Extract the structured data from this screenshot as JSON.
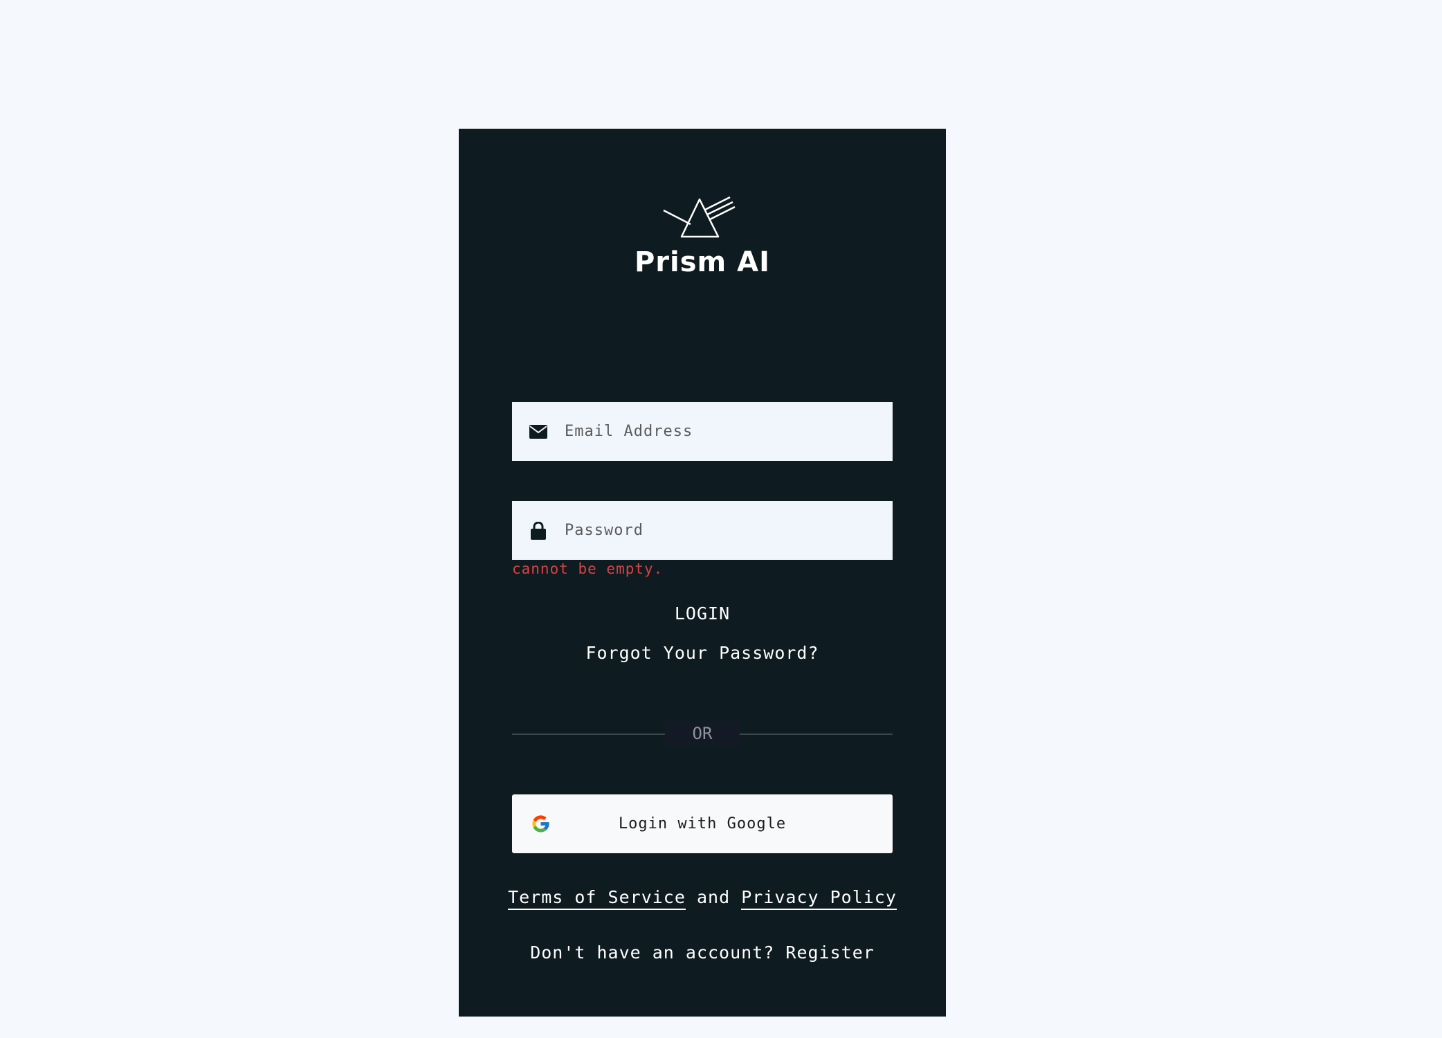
{
  "brand": {
    "name": "Prism AI",
    "logo_icon": "prism-icon"
  },
  "form": {
    "email": {
      "icon": "envelope-icon",
      "placeholder": "Email Address",
      "value": ""
    },
    "password": {
      "icon": "lock-icon",
      "placeholder": "Password",
      "value": "",
      "error": "cannot be empty."
    },
    "login_label": "LOGIN",
    "forgot_label": "Forgot Your Password?"
  },
  "divider": {
    "label": "OR"
  },
  "google": {
    "icon": "google-icon",
    "label": "Login with Google"
  },
  "legal": {
    "terms": "Terms of Service",
    "and": "and",
    "privacy": "Privacy Policy"
  },
  "signup": {
    "prompt": "Don't have an account?",
    "link": "Register"
  },
  "colors": {
    "page_background": "#f5f9fd",
    "card_background": "#0e1b21",
    "input_background": "#f1f6fd",
    "error": "#d84343",
    "divider_label": "#8f9499"
  }
}
